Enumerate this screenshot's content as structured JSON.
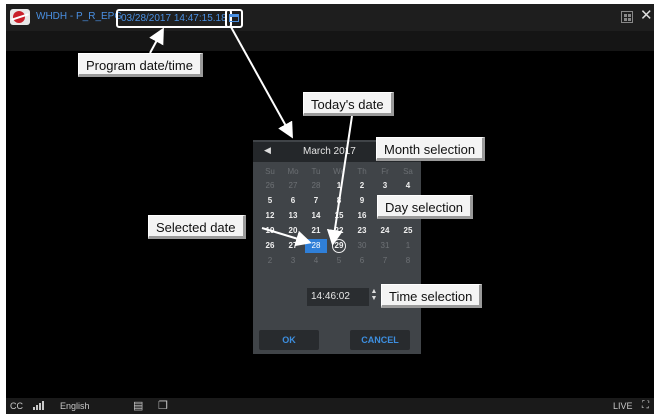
{
  "header": {
    "channel_label": "WHDH - P_R_EPG",
    "datetime": "03/28/2017 14:47:15.18"
  },
  "picker": {
    "month_title": "March 2017",
    "weekdays": [
      "Su",
      "Mo",
      "Tu",
      "We",
      "Th",
      "Fr",
      "Sa"
    ],
    "weeks": [
      [
        [
          "26",
          "oth"
        ],
        [
          "27",
          "oth"
        ],
        [
          "28",
          "oth"
        ],
        [
          "1",
          "cur"
        ],
        [
          "2",
          "cur"
        ],
        [
          "3",
          "cur"
        ],
        [
          "4",
          "cur"
        ]
      ],
      [
        [
          "5",
          "cur"
        ],
        [
          "6",
          "cur"
        ],
        [
          "7",
          "cur"
        ],
        [
          "8",
          "cur"
        ],
        [
          "9",
          "cur"
        ],
        [
          "10",
          "cur"
        ],
        [
          "11",
          "cur"
        ]
      ],
      [
        [
          "12",
          "cur"
        ],
        [
          "13",
          "cur"
        ],
        [
          "14",
          "cur"
        ],
        [
          "15",
          "cur"
        ],
        [
          "16",
          "cur"
        ],
        [
          "17",
          "cur"
        ],
        [
          "18",
          "cur"
        ]
      ],
      [
        [
          "19",
          "cur"
        ],
        [
          "20",
          "cur"
        ],
        [
          "21",
          "cur"
        ],
        [
          "22",
          "cur"
        ],
        [
          "23",
          "cur"
        ],
        [
          "24",
          "cur"
        ],
        [
          "25",
          "cur"
        ]
      ],
      [
        [
          "26",
          "cur"
        ],
        [
          "27",
          "cur"
        ],
        [
          "28",
          "sel"
        ],
        [
          "29",
          "today"
        ],
        [
          "30",
          "oth"
        ],
        [
          "31",
          "oth"
        ],
        [
          "1",
          "oth"
        ]
      ],
      [
        [
          "2",
          "oth"
        ],
        [
          "3",
          "oth"
        ],
        [
          "4",
          "oth"
        ],
        [
          "5",
          "oth"
        ],
        [
          "6",
          "oth"
        ],
        [
          "7",
          "oth"
        ],
        [
          "8",
          "oth"
        ]
      ]
    ],
    "time_value": "14:46:02",
    "ok_label": "OK",
    "cancel_label": "CANCEL"
  },
  "bottom": {
    "cc_label": "CC",
    "language_label": "English",
    "live_label": "LIVE"
  },
  "callouts": {
    "program_datetime": "Program date/time",
    "todays_date": "Today's date",
    "month_selection": "Month selection",
    "day_selection": "Day selection",
    "selected_date": "Selected date",
    "time_selection": "Time selection"
  },
  "colors": {
    "accent_blue": "#4a90e2",
    "selected_day": "#2f7fd8",
    "player_bg": "#000000",
    "picker_bg": "#404448"
  },
  "icons": {
    "logo": "channel-logo",
    "calendar": "calendar-icon",
    "grid": "grid-layout-icon",
    "close": "close-icon",
    "signal": "signal-bars-icon",
    "subtitles": "subtitle-icon",
    "window": "window-icon",
    "fullscreen": "fullscreen-icon"
  }
}
